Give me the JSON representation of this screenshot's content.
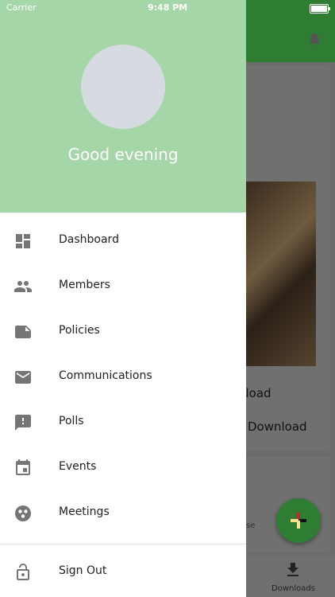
{
  "status_bar": {
    "carrier": "Carrier",
    "time": "9:48 PM"
  },
  "drawer": {
    "greeting": "Good evening",
    "menu": [
      {
        "label": "Dashboard",
        "icon": "dashboard-icon"
      },
      {
        "label": "Members",
        "icon": "people-icon"
      },
      {
        "label": "Policies",
        "icon": "note-icon"
      },
      {
        "label": "Communications",
        "icon": "mail-icon"
      },
      {
        "label": "Polls",
        "icon": "feedback-icon"
      },
      {
        "label": "Events",
        "icon": "calendar-icon"
      },
      {
        "label": "Meetings",
        "icon": "meeting-icon"
      }
    ],
    "sign_out": {
      "label": "Sign Out",
      "icon": "lock-icon"
    }
  },
  "background": {
    "download_label_partial": "nload",
    "download_label": "Download",
    "card_text_partial": "se",
    "bottom_nav": {
      "downloads_label": "Downloads"
    }
  },
  "colors": {
    "header_green": "#a5d6a7",
    "app_bar_green": "#2e7d32",
    "icon_gray": "#757575"
  }
}
